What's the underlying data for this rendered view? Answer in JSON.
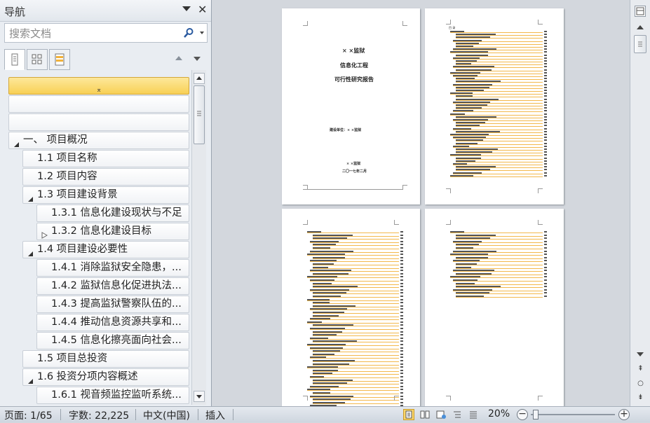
{
  "nav": {
    "title": "导航",
    "search_placeholder": "搜索文档",
    "tabs": [
      "浏览标题",
      "浏览页面",
      "浏览搜索结果"
    ],
    "tree": [
      {
        "label": "",
        "level": 0,
        "type": "top"
      },
      {
        "label": "",
        "level": 0,
        "type": "blank"
      },
      {
        "label": "",
        "level": 0,
        "type": "blank"
      },
      {
        "label": "一、 项目概况",
        "level": 0,
        "type": "expanded"
      },
      {
        "label": "1.1 项目名称",
        "level": 1,
        "type": "leaf"
      },
      {
        "label": "1.2 项目内容",
        "level": 1,
        "type": "leaf"
      },
      {
        "label": "1.3 项目建设背景",
        "level": 1,
        "type": "expanded"
      },
      {
        "label": "1.3.1 信息化建设现状与不足",
        "level": 2,
        "type": "leaf"
      },
      {
        "label": "1.3.2 信息化建设目标",
        "level": 2,
        "type": "collapsed"
      },
      {
        "label": "1.4 项目建设必要性",
        "level": 1,
        "type": "expanded"
      },
      {
        "label": "1.4.1 消除监狱安全隐患，...",
        "level": 2,
        "type": "leaf"
      },
      {
        "label": "1.4.2 监狱信息化促进执法...",
        "level": 2,
        "type": "leaf"
      },
      {
        "label": "1.4.3 提高监狱警察队伍的...",
        "level": 2,
        "type": "leaf"
      },
      {
        "label": "1.4.4 推动信息资源共享和...",
        "level": 2,
        "type": "leaf"
      },
      {
        "label": "1.4.5 信息化擦亮面向社会...",
        "level": 2,
        "type": "leaf"
      },
      {
        "label": "1.5 项目总投资",
        "level": 1,
        "type": "leaf"
      },
      {
        "label": "1.6 投资分项内容概述",
        "level": 1,
        "type": "expanded"
      },
      {
        "label": "1.6.1 视音频监控监听系统...",
        "level": 2,
        "type": "leaf"
      }
    ]
  },
  "cover": {
    "line1": "× ×监狱",
    "line2": "信息化工程",
    "line3": "可行性研究报告",
    "unit": "建设单位：× ×监狱",
    "org": "× ×监狱",
    "date": "二〇一七年二月"
  },
  "toc_title": "目  录",
  "status": {
    "page": "页面: 1/65",
    "words": "字数: 22,225",
    "lang": "中文(中国)",
    "mode": "插入",
    "zoom": "20%"
  },
  "zoom_percent": 20
}
